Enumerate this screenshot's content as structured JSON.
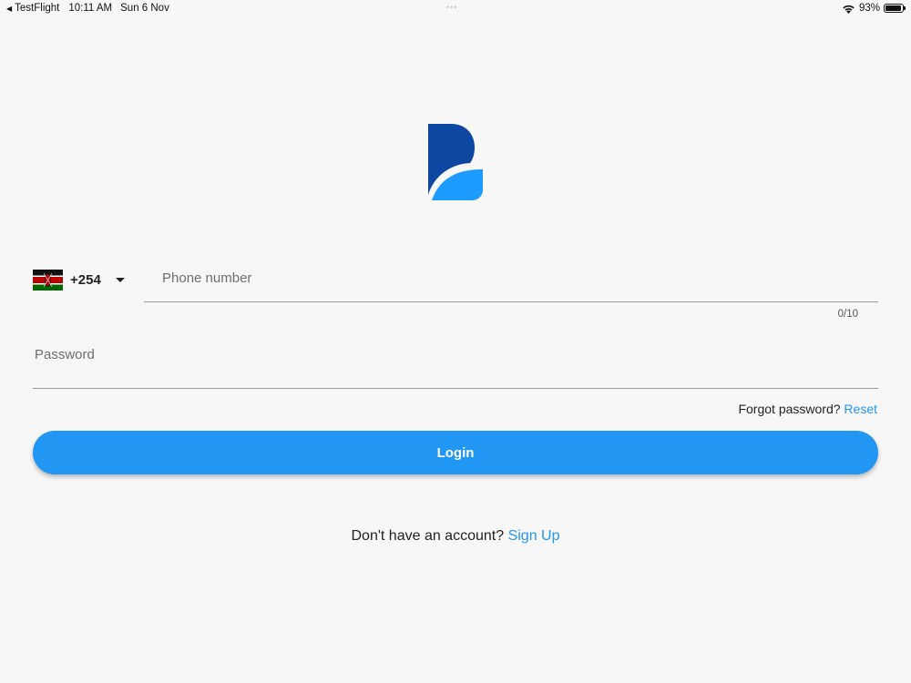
{
  "status_bar": {
    "back_app": "TestFlight",
    "time": "10:11 AM",
    "date": "Sun 6 Nov",
    "battery_percent": "93%",
    "battery_level": 0.93
  },
  "logo": {
    "icon": "brand-b-logo",
    "colors": {
      "dark": "#0d47a1",
      "light": "#1e9bff"
    }
  },
  "phone": {
    "country_flag": "kenya-flag-icon",
    "dial_code": "+254",
    "placeholder": "Phone number",
    "counter": "0/10"
  },
  "password": {
    "placeholder": "Password"
  },
  "forgot": {
    "text": "Forgot password?",
    "link": "Reset"
  },
  "login": {
    "label": "Login"
  },
  "signup": {
    "text": "Don't have an account?",
    "link": "Sign Up"
  },
  "colors": {
    "accent": "#2196f3",
    "background": "#f7f7f8"
  }
}
